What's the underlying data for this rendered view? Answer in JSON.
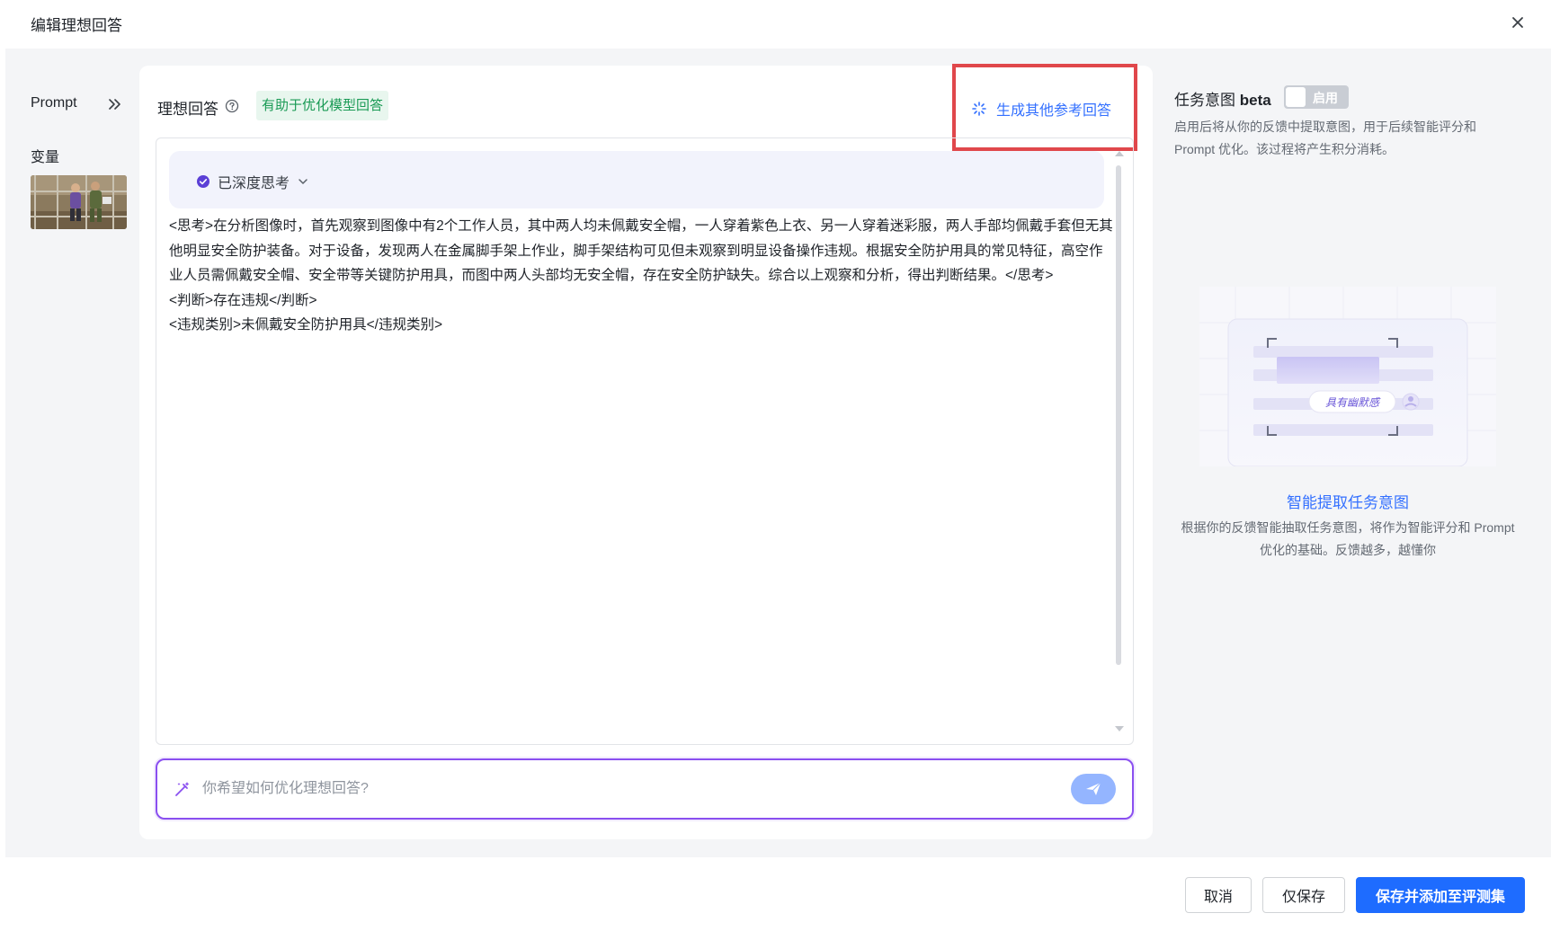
{
  "modal": {
    "title": "编辑理想回答"
  },
  "left_nav": {
    "prompt_label": "Prompt",
    "variables_label": "变量"
  },
  "main": {
    "label": "理想回答",
    "tag": "有助于优化模型回答",
    "generate_link": "生成其他参考回答",
    "thinking_label": "已深度思考",
    "answer_text": "<思考>在分析图像时，首先观察到图像中有2个工作人员，其中两人均未佩戴安全帽，一人穿着紫色上衣、另一人穿着迷彩服，两人手部均佩戴手套但无其他明显安全防护装备。对于设备，发现两人在金属脚手架上作业，脚手架结构可见但未观察到明显设备操作违规。根据安全防护用具的常见特征，高空作业人员需佩戴安全帽、安全带等关键防护用具，而图中两人头部均无安全帽，存在安全防护缺失。综合以上观察和分析，得出判断结果。</思考>\n<判断>存在违规</判断>\n<违规类别>未佩戴安全防护用具</违规类别>",
    "optimize_placeholder": "你希望如何优化理想回答?"
  },
  "right_panel": {
    "title": "任务意图",
    "title_suffix": "beta",
    "toggle_label": "启用",
    "toggle_on": false,
    "description": "启用后将从你的反馈中提取意图，用于后续智能评分和 Prompt 优化。该过程将产生积分消耗。",
    "illustration_tag": "具有幽默感",
    "illustration_title": "智能提取任务意图",
    "illustration_desc": "根据你的反馈智能抽取任务意图，将作为智能评分和 Prompt 优化的基础。反馈越多，越懂你"
  },
  "footer": {
    "cancel": "取消",
    "save_only": "仅保存",
    "save_and_add": "保存并添加至评测集"
  },
  "colors": {
    "primary": "#1e6cff",
    "link": "#3370ff",
    "highlight_box": "#e0474b",
    "input_border": "#8a4ff0",
    "tag_green": "#1a9a55"
  }
}
